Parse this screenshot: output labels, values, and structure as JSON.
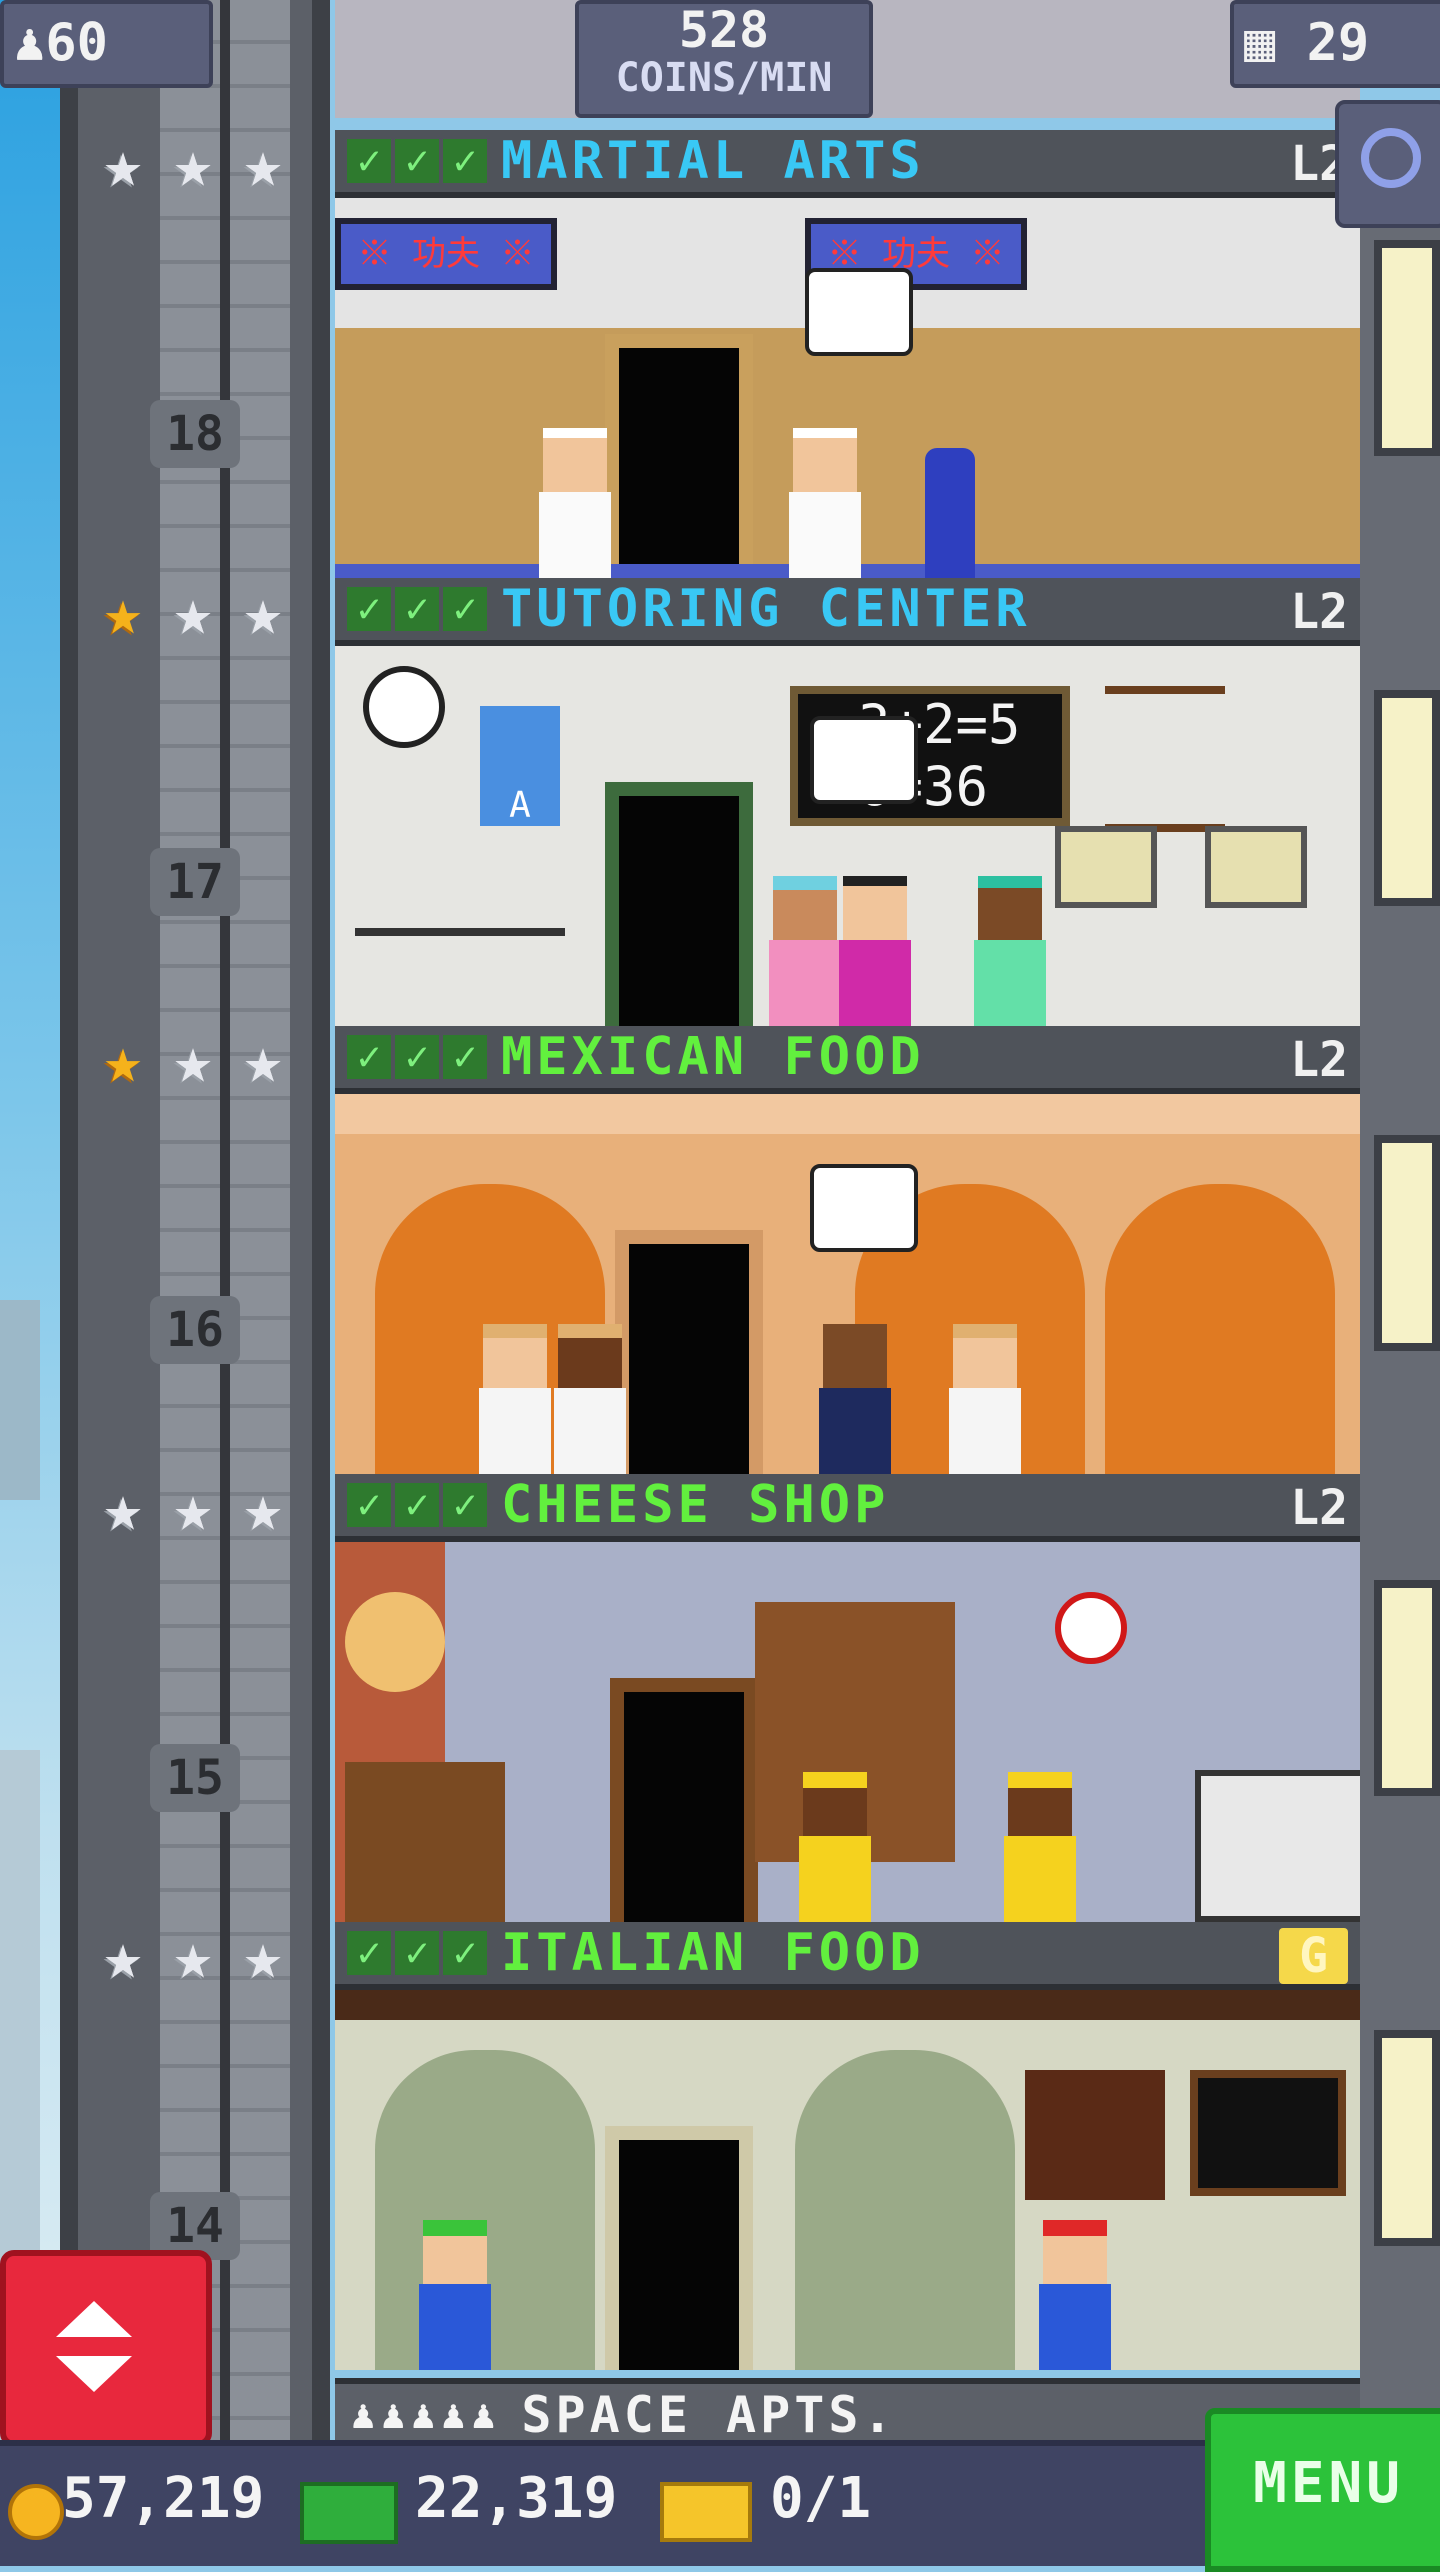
{
  "header": {
    "population": "60",
    "coin_rate_value": "528",
    "coin_rate_unit": "COINS/MIN",
    "floor_count": "29"
  },
  "floors": [
    {
      "number": "18",
      "name": "MARTIAL ARTS",
      "level": "L2",
      "stars_gold": 0,
      "name_color": "blue",
      "signs": [
        "※ 功夫 ※",
        "※ 功夫 ※"
      ]
    },
    {
      "number": "17",
      "name": "TUTORING CENTER",
      "level": "L2",
      "stars_gold": 1,
      "name_color": "blue",
      "chalkboard": [
        "3+2=5",
        "6=36"
      ],
      "poster": "A"
    },
    {
      "number": "16",
      "name": "MEXICAN FOOD",
      "level": "L2",
      "stars_gold": 1,
      "name_color": "green"
    },
    {
      "number": "15",
      "name": "CHEESE SHOP",
      "level": "L2",
      "stars_gold": 0,
      "name_color": "green"
    },
    {
      "number": "14",
      "name": "ITALIAN FOOD",
      "level": "G",
      "stars_gold": 0,
      "name_color": "green"
    }
  ],
  "next_floor": {
    "name": "SPACE APTS.",
    "residents": "♟♟♟♟♟"
  },
  "bottom": {
    "coins": "57,219",
    "bux": "22,319",
    "tickets": "0/1",
    "menu_label": "MENU"
  },
  "colors": {
    "gold_star": "#f5b21b",
    "check_green": "#2e7a2e",
    "menu_green": "#2cc23a",
    "elevator_red": "#e8283d"
  },
  "icons": [
    "population-icon",
    "floors-icon",
    "search-icon",
    "coin-icon",
    "bux-icon",
    "ticket-icon",
    "elevator-arrows-icon",
    "star-icon",
    "check-icon"
  ]
}
